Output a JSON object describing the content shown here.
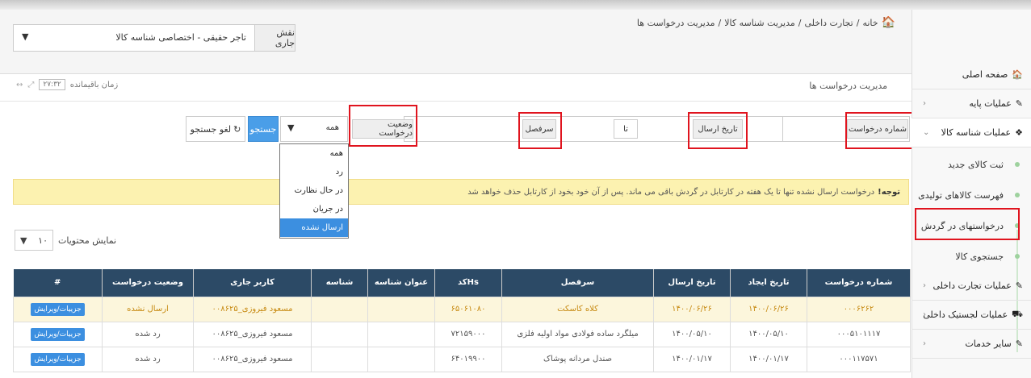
{
  "breadcrumb": {
    "home": "خانه",
    "sep": "/",
    "l1": "تجارت داخلی",
    "l2": "مدیریت شناسه کالا",
    "l3": "مدیریت درخواست ها"
  },
  "role": {
    "label": "نقش جاری",
    "value": "تاجر حقیقی - اختصاصی شناسه کالا"
  },
  "page_title": "مدیریت درخواست ها",
  "timer": {
    "label": "زمان باقیمانده",
    "value": "۲۷:۳۲"
  },
  "filters": {
    "request_number": "شماره درخواست",
    "send_date": "تاریخ ارسال",
    "to": "تا",
    "heading": "سرفصل",
    "status": "وضعیت درخواست",
    "status_value": "همه",
    "search": "جستجو",
    "clear": "لغو جستجو"
  },
  "status_options": [
    "همه",
    "رد",
    "در حال نظارت",
    "در جریان",
    "ارسال نشده"
  ],
  "notice": {
    "bold": "توجه!",
    "text": "درخواست ارسال نشده تنها تا یک هفته در کارتابل در گردش باقی می ماند. پس از آن خود بخود از کارتابل حذف خواهد شد"
  },
  "page_size": {
    "label": "نمایش محتویات",
    "value": "۱۰"
  },
  "table": {
    "headers": [
      "شماره درخواست",
      "تاریخ ایجاد",
      "تاریخ ارسال",
      "سرفصل",
      "Hsکد",
      "عنوان شناسه",
      "شناسه",
      "کاربر جاری",
      "وضعیت درخواست",
      "#"
    ],
    "rows": [
      [
        "۰۰۰۶۲۶۲",
        "۱۴۰۰/۰۶/۲۶",
        "۱۴۰۰/۰۶/۲۶",
        "کلاه کاسکت",
        "۶۵۰۶۱۰۸۰",
        "",
        "",
        "مسعود فیروزی_۰۰۸۶۲۵",
        "ارسال نشده",
        "جزییات/ویرایش"
      ],
      [
        "۰۰۰۵۱۰۱۱۱۷",
        "۱۴۰۰/۰۵/۱۰",
        "۱۴۰۰/۰۵/۱۰",
        "میلگرد ساده فولادی مواد اولیه فلزی",
        "۷۲۱۵۹۰۰۰",
        "",
        "",
        "مسعود فیروزی_۰۰۸۶۲۵",
        "رد شده",
        "جزییات/ویرایش"
      ],
      [
        "۰۰۰۱۱۷۵۷۱",
        "۱۴۰۰/۰۱/۱۷",
        "۱۴۰۰/۰۱/۱۷",
        "صندل مردانه پوشاک",
        "۶۴۰۱۹۹۰۰",
        "",
        "",
        "مسعود فیروزی_۰۰۸۶۲۵",
        "رد شده",
        "جزییات/ویرایش"
      ]
    ]
  },
  "sidebar": {
    "home": "صفحه اصلی",
    "base_ops": "عملیات پایه",
    "product_id_ops": "عملیات شناسه کالا",
    "sub": [
      "ثبت کالای جدید",
      "فهرست کالاهای تولیدی",
      "درخواستهای در گردش",
      "جستجوی کالا"
    ],
    "domestic_trade": "عملیات تجارت داخلی",
    "domestic_logistics": "عملیات لجستیک داخلی",
    "other": "سایر خدمات"
  },
  "colors": {
    "accent": "#3c8fe0",
    "table_header": "#2c4a66",
    "highlight": "#e0141e",
    "notice_bg": "#fcf2b0"
  }
}
